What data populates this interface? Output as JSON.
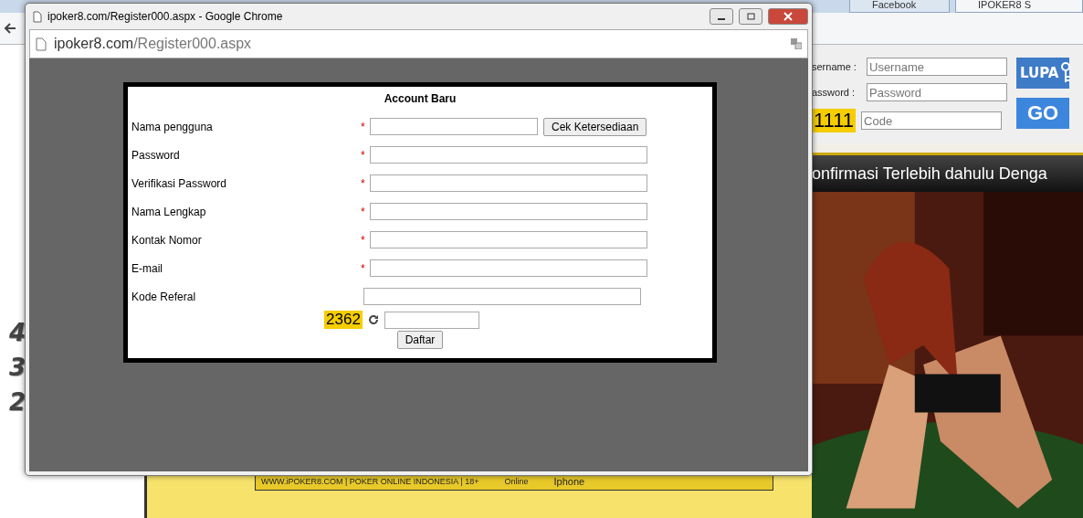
{
  "browser": {
    "tabs": [
      {
        "label": "Facebook",
        "selected": false
      },
      {
        "label": "IPOKER8 S",
        "selected": true
      }
    ]
  },
  "site": {
    "left_digits": [
      "4",
      "3",
      "2"
    ],
    "login": {
      "rows": [
        {
          "label": "sername :",
          "placeholder": "Username"
        },
        {
          "label": "assword :",
          "placeholder": "Password"
        },
        {
          "label": "1111",
          "placeholder": "Code",
          "kind": "captcha"
        }
      ],
      "lupa": "LUPA",
      "go": "GO"
    },
    "banner": "onfirmasi Terlebih dahulu Denga",
    "footer": {
      "text": "WWW.iPOKER8.COM | POKER ONLINE INDONESIA | 18+",
      "online": "Online",
      "iphone": "Iphone"
    }
  },
  "popup": {
    "title": "ipoker8.com/Register000.aspx - Google Chrome",
    "url_host": "ipoker8.com",
    "url_path": "/Register000.aspx",
    "form": {
      "title": "Account Baru",
      "required_mark": "*",
      "fields": [
        {
          "label": "Nama pengguna",
          "required": true,
          "button": "Cek Ketersediaan"
        },
        {
          "label": "Password",
          "required": true
        },
        {
          "label": "Verifikasi Password",
          "required": true
        },
        {
          "label": "Nama Lengkap",
          "required": true
        },
        {
          "label": "Kontak Nomor",
          "required": true
        },
        {
          "label": "E-mail",
          "required": true
        },
        {
          "label": "Kode Referal",
          "required": false
        }
      ],
      "captcha": "2362",
      "submit": "Daftar"
    }
  }
}
